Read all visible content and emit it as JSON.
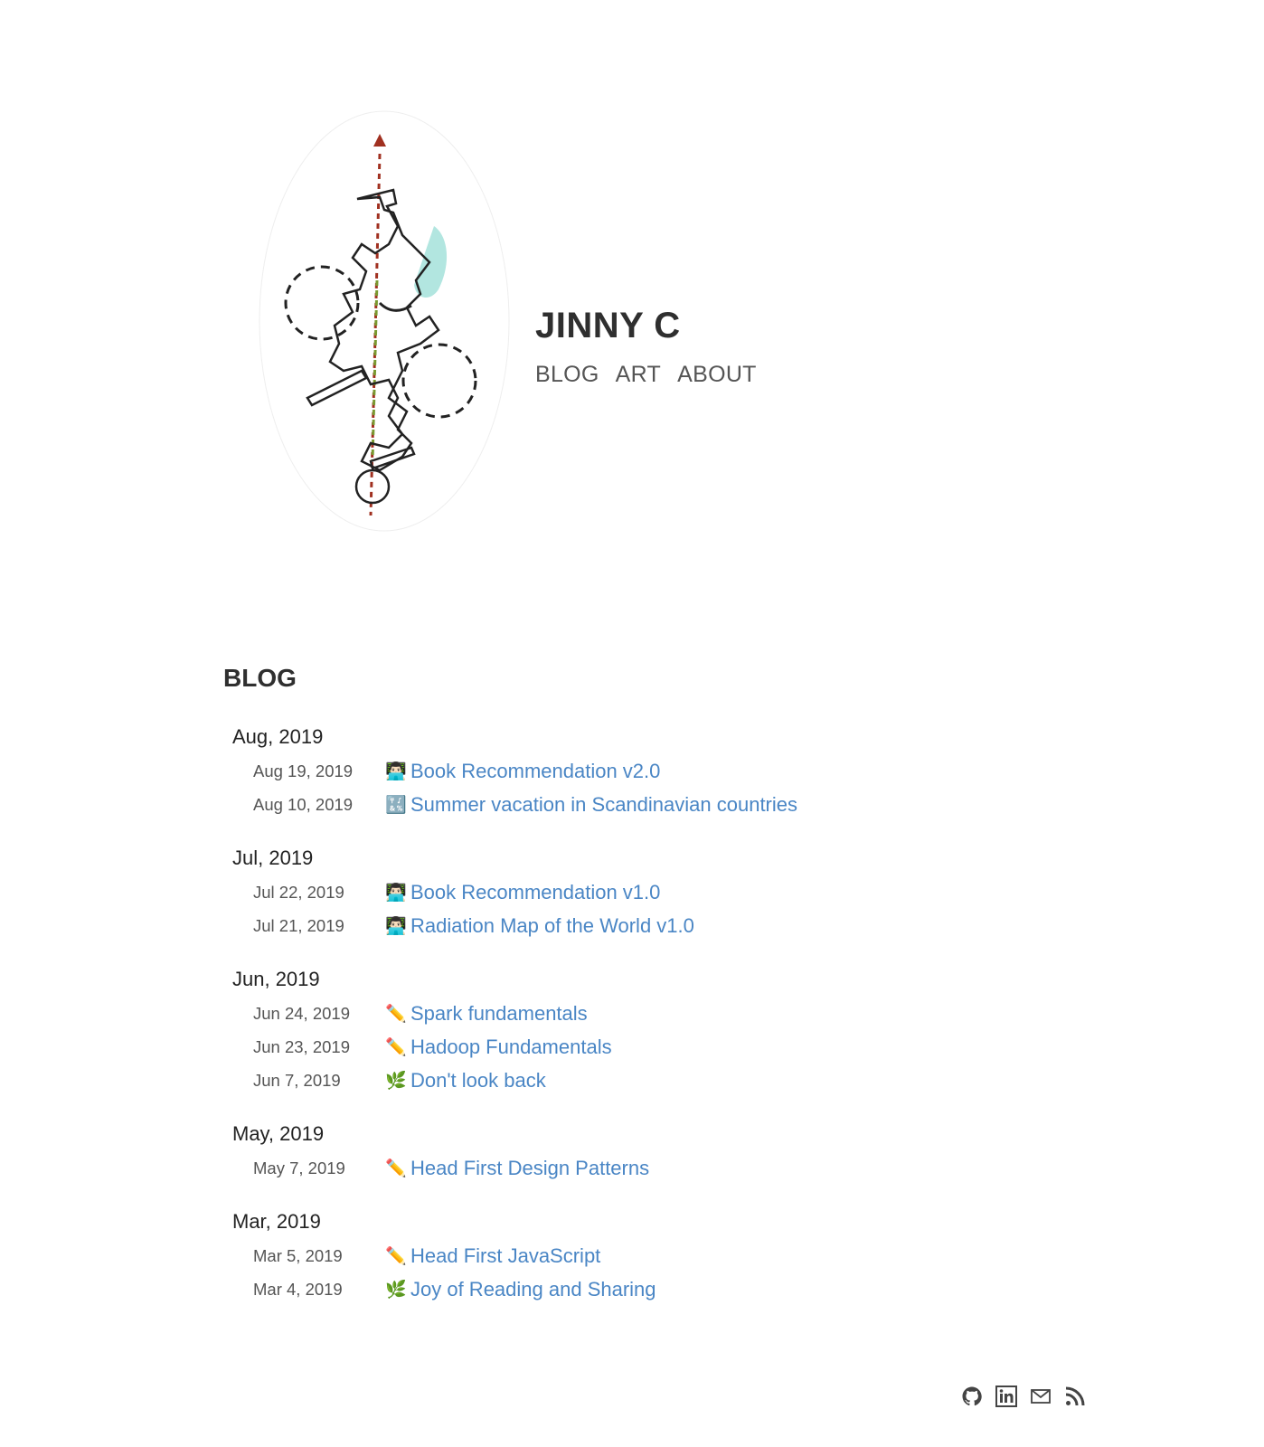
{
  "site": {
    "title": "JINNY C"
  },
  "nav": {
    "items": [
      "BLOG",
      "ART",
      "ABOUT"
    ]
  },
  "blog": {
    "heading": "BLOG",
    "months": [
      {
        "label": "Aug, 2019",
        "posts": [
          {
            "date": "Aug 19, 2019",
            "icon": "👨🏻‍💻",
            "title": "Book Recommendation v2.0"
          },
          {
            "date": "Aug 10, 2019",
            "icon": "🔣",
            "title": "Summer vacation in Scandinavian countries"
          }
        ]
      },
      {
        "label": "Jul, 2019",
        "posts": [
          {
            "date": "Jul 22, 2019",
            "icon": "👨🏻‍💻",
            "title": "Book Recommendation v1.0"
          },
          {
            "date": "Jul 21, 2019",
            "icon": "👨🏻‍💻",
            "title": "Radiation Map of the World v1.0"
          }
        ]
      },
      {
        "label": "Jun, 2019",
        "posts": [
          {
            "date": "Jun 24, 2019",
            "icon": "✏️",
            "title": "Spark fundamentals"
          },
          {
            "date": "Jun 23, 2019",
            "icon": "✏️",
            "title": "Hadoop Fundamentals"
          },
          {
            "date": "Jun 7, 2019",
            "icon": "🌿",
            "title": "Don't look back"
          }
        ]
      },
      {
        "label": "May, 2019",
        "posts": [
          {
            "date": "May 7, 2019",
            "icon": "✏️",
            "title": "Head First Design Patterns"
          }
        ]
      },
      {
        "label": "Mar, 2019",
        "posts": [
          {
            "date": "Mar 5, 2019",
            "icon": "✏️",
            "title": "Head First JavaScript"
          },
          {
            "date": "Mar 4, 2019",
            "icon": "🌿",
            "title": "Joy of Reading and Sharing"
          }
        ]
      }
    ]
  },
  "footer": {
    "icons": [
      "github-icon",
      "linkedin-icon",
      "mail-icon",
      "rss-icon"
    ]
  },
  "colors": {
    "link": "#4a86c5",
    "title": "#2f2f2f"
  }
}
